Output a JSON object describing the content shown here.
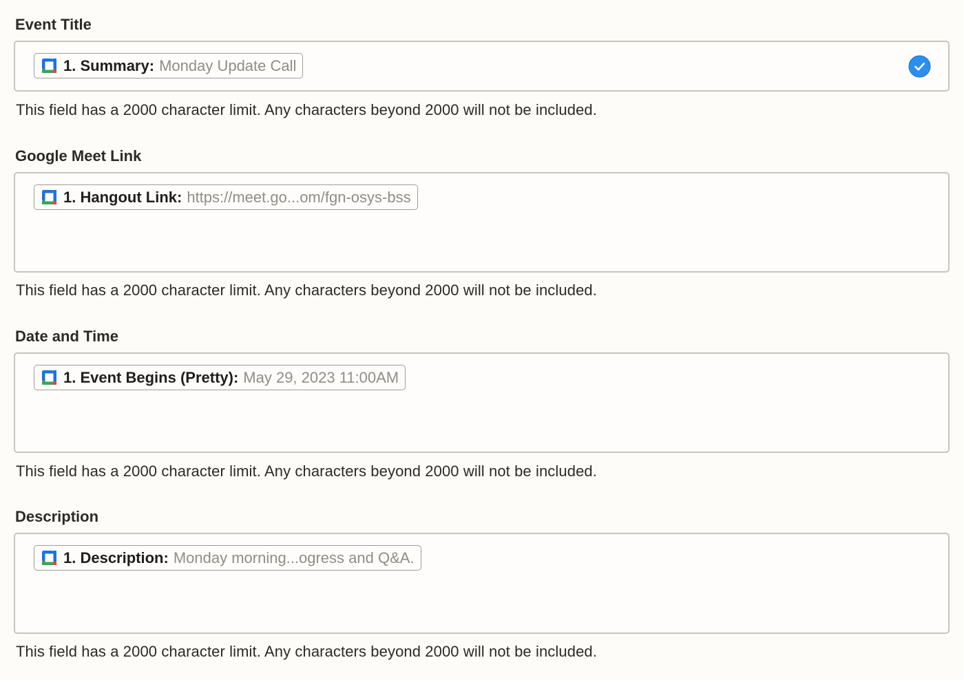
{
  "fields": [
    {
      "label": "Event Title",
      "pill_key": "1. Summary:",
      "pill_value": "Monday Update Call",
      "help": "This field has a 2000 character limit. Any characters beyond 2000 will not be included.",
      "valid": true
    },
    {
      "label": "Google Meet Link",
      "pill_key": "1. Hangout Link:",
      "pill_value": "https://meet.go...om/fgn-osys-bss",
      "help": "This field has a 2000 character limit. Any characters beyond 2000 will not be included."
    },
    {
      "label": "Date and Time",
      "pill_key": "1. Event Begins (Pretty):",
      "pill_value": "May 29, 2023 11:00AM",
      "help": "This field has a 2000 character limit. Any characters beyond 2000 will not be included."
    },
    {
      "label": "Description",
      "pill_key": "1. Description:",
      "pill_value": "Monday morning...ogress and Q&A.",
      "help": "This field has a 2000 character limit. Any characters beyond 2000 will not be included."
    }
  ],
  "icons": {
    "pill_icon": "google-calendar-icon",
    "valid_icon": "check-circle-icon"
  },
  "colors": {
    "check_blue": "#2b8ff0",
    "border": "#c7c5bd",
    "pill_border": "#9f9d96",
    "value_gray": "#8f8d86"
  }
}
